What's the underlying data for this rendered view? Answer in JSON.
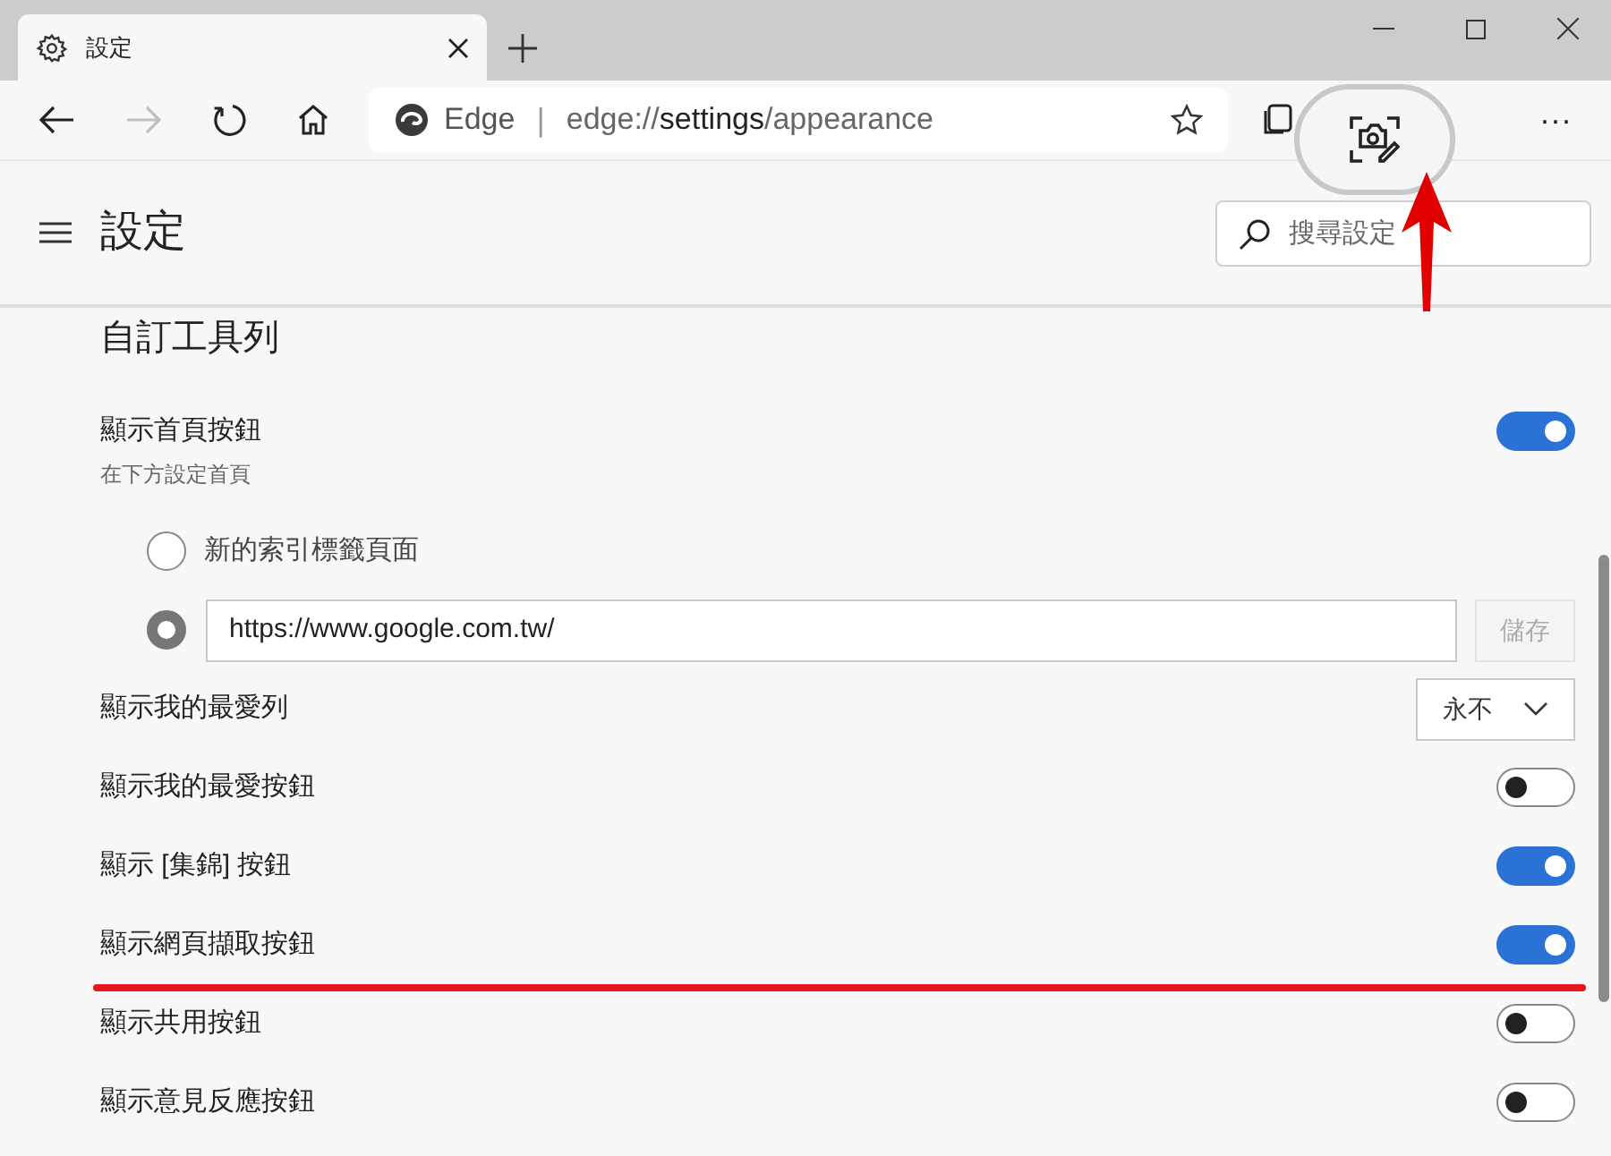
{
  "tab": {
    "title": "設定"
  },
  "address_bar": {
    "site_label": "Edge",
    "separator": "|",
    "url_parts": [
      {
        "text": "edge://",
        "emphasis": false
      },
      {
        "text": "settings",
        "emphasis": true
      },
      {
        "text": "/appearance",
        "emphasis": false
      }
    ]
  },
  "toolbar": {
    "more_label": "···"
  },
  "header": {
    "title": "設定",
    "search": {
      "placeholder": "搜尋設定"
    }
  },
  "section": {
    "title": "自訂工具列",
    "items": [
      {
        "kind": "toggle",
        "label": "顯示首頁按鈕",
        "description": "在下方設定首頁",
        "on": true,
        "highlighted": false
      },
      {
        "kind": "radio",
        "label": "新的索引標籤頁面",
        "selected": false
      },
      {
        "kind": "radio_input",
        "value": "https://www.google.com.tw/",
        "selected": true,
        "button": "儲存",
        "button_disabled": true
      },
      {
        "kind": "select",
        "label": "顯示我的最愛列",
        "value": "永不"
      },
      {
        "kind": "toggle",
        "label": "顯示我的最愛按鈕",
        "on": false,
        "highlighted": false
      },
      {
        "kind": "toggle",
        "label": "顯示 [集錦] 按鈕",
        "on": true,
        "highlighted": false
      },
      {
        "kind": "toggle",
        "label": "顯示網頁擷取按鈕",
        "on": true,
        "highlighted": true
      },
      {
        "kind": "toggle",
        "label": "顯示共用按鈕",
        "on": false,
        "highlighted": false
      },
      {
        "kind": "toggle",
        "label": "顯示意見反應按鈕",
        "on": false,
        "highlighted": false
      }
    ]
  }
}
